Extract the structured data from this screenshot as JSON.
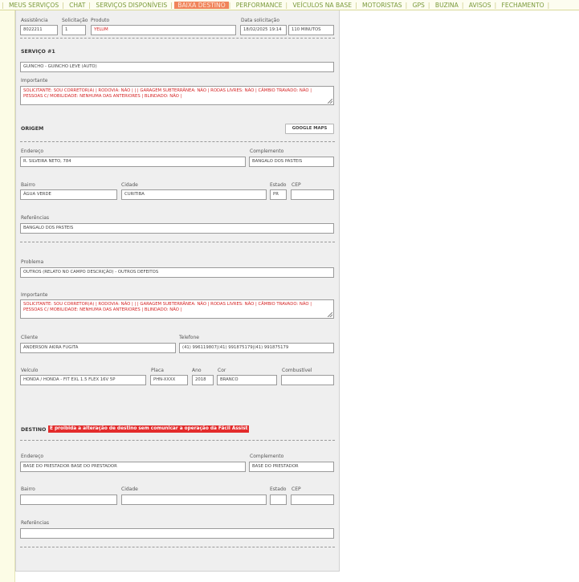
{
  "nav": {
    "items": [
      "MEUS SERVIÇOS",
      "CHAT",
      "SERVIÇOS DISPONÍVEIS",
      "BAIXA DESTINO",
      "PERFORMANCE",
      "VEÍCULOS NA BASE",
      "MOTORISTAS",
      "GPS",
      "BUZINA",
      "AVISOS",
      "FECHAMENTO"
    ],
    "active_index": 3
  },
  "header": {
    "assistencia_label": "Assistência",
    "assistencia_value": "8022211",
    "solicitacao_label": "Solicitação",
    "solicitacao_value": "1",
    "produto_label": "Produto",
    "produto_value": "YELUM",
    "data_label": "Data solicitação",
    "data_value": "18/02/2025 19:14",
    "minutos_value": "110 MINUTOS"
  },
  "servico": {
    "title": "SERVIÇO #1",
    "tipo_value": "GUINCHO - GUINCHO LEVE (AUTO)",
    "importante_label": "Importante",
    "importante_text": "SOLICITANTE: SOU CORRETOR(A) | RODOVIA: NÃO | | | GARAGEM SUBTERRÂNEA: NÃO | RODAS LIVRES: NÃO | CÂMBIO TRAVADO: NÃO | PESSOAS C/ MOBILIDADE: NENHUMA DAS ANTERIORES | BLINDADO: NÃO |"
  },
  "origem": {
    "title": "ORIGEM",
    "gmaps_label": "GOOGLE MAPS",
    "endereco_label": "Endereço",
    "endereco_value": "R. SILVEIRA NETO, 784",
    "complemento_label": "Complemento",
    "complemento_value": "BANGALO DOS PASTEIS",
    "bairro_label": "Bairro",
    "bairro_value": "ÁGUA VERDE",
    "cidade_label": "Cidade",
    "cidade_value": "CURITIBA",
    "estado_label": "Estado",
    "estado_value": "PR",
    "cep_label": "CEP",
    "cep_value": "",
    "referencias_label": "Referências",
    "referencias_value": "BANGALO DOS PASTEIS"
  },
  "problema": {
    "label": "Problema",
    "value": "OUTROS (RELATO NO CAMPO DESCRIÇÃO) - OUTROS DEFEITOS",
    "importante_label": "Importante",
    "importante_text": "SOLICITANTE: SOU CORRETOR(A) | RODOVIA: NÃO | | | GARAGEM SUBTERRÂNEA: NÃO | RODAS LIVRES: NÃO | CÂMBIO TRAVADO: NÃO | PESSOAS C/ MOBILIDADE: NENHUMA DAS ANTERIORES | BLINDADO: NÃO |"
  },
  "cliente": {
    "label": "Cliente",
    "value": "ANDERSON AKIRA FUGITA",
    "telefone_label": "Telefone",
    "telefone_value": "(41) 996119807|(41) 991875179|(41) 991875179"
  },
  "veiculo": {
    "label": "Veículo",
    "value": "HONDA / HONDA - FIT EXL 1.5 FLEX 16V 5P",
    "placa_label": "Placa",
    "placa_value": "PHN-XXXX",
    "ano_label": "Ano",
    "ano_value": "2018",
    "cor_label": "Cor",
    "cor_value": "BRANCO",
    "combustivel_label": "Combustível",
    "combustivel_value": ""
  },
  "destino": {
    "title": "DESTINO",
    "warning": "É proibida a alteração de destino sem comunicar a operação da Fácil Assist",
    "endereco_label": "Endereço",
    "endereco_value": "BASE DO PRESTADOR BASE DO PRESTADOR",
    "complemento_label": "Complemento",
    "complemento_value": "BASE DO PRESTADOR",
    "bairro_label": "Bairro",
    "bairro_value": "",
    "cidade_label": "Cidade",
    "cidade_value": "",
    "estado_label": "Estado",
    "estado_value": "",
    "cep_label": "CEP",
    "cep_value": "",
    "referencias_label": "Referências",
    "referencias_value": ""
  },
  "colors": {
    "nav_text": "#7a9a3a",
    "nav_active_bg": "#f0845a",
    "warn_bg": "#e32b2b",
    "important_text": "#d42020"
  }
}
